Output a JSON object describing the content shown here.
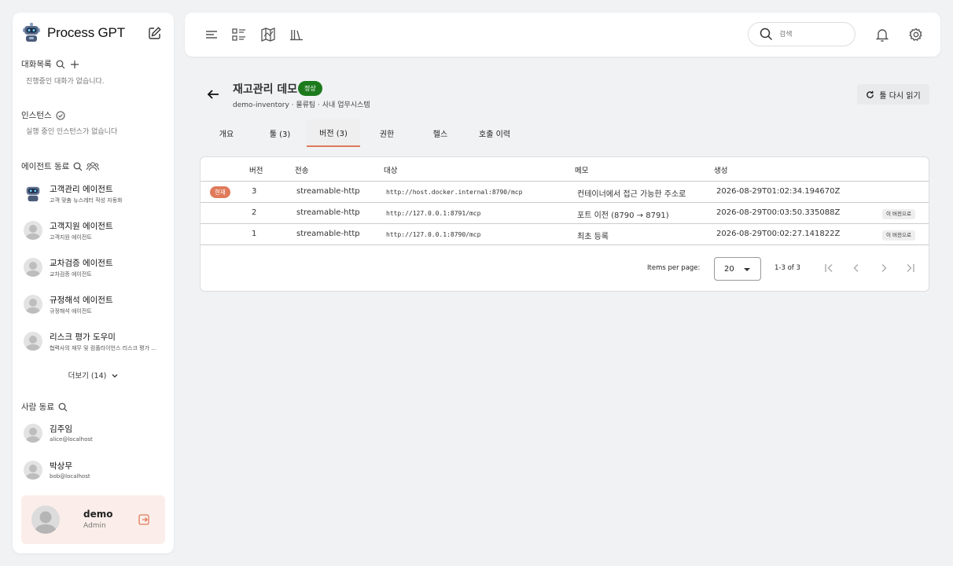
{
  "app": {
    "name": "Process GPT"
  },
  "sidebar": {
    "conversations": {
      "title": "대화목록",
      "empty": "진행중인 대화가 없습니다."
    },
    "instances": {
      "title": "인스턴스",
      "empty": "실행 중인 인스턴스가 없습니다"
    },
    "agents": {
      "title": "에이전트 동료",
      "items": [
        {
          "name": "고객관리 에이전트",
          "desc": "고객 맞춤 뉴스레터 작성 자동화"
        },
        {
          "name": "고객지원 에이전트",
          "desc": "고객지원 에이전트"
        },
        {
          "name": "교차검증 에이전트",
          "desc": "교차검증 에이전트"
        },
        {
          "name": "규정해석 에이전트",
          "desc": "규정해석 에이전트"
        },
        {
          "name": "리스크 평가 도우미",
          "desc": "협력사의 재무 및 컴플라이언스 리스크 평가 ..."
        }
      ],
      "more": "더보기 (14)"
    },
    "people": {
      "title": "사람 동료",
      "items": [
        {
          "name": "김주임",
          "email": "alice@localhost"
        },
        {
          "name": "박상무",
          "email": "bob@localhost"
        }
      ]
    },
    "user": {
      "name": "demo",
      "role": "Admin"
    }
  },
  "topbar": {
    "search_placeholder": "검색"
  },
  "page": {
    "title": "재고관리 데모",
    "status": "정상",
    "subtitle": "demo-inventory · 물류팀 · 사내 업무시스템",
    "reload_label": "툴 다시 읽기",
    "accent": "#e07a5a",
    "status_color": "#1c7a1c"
  },
  "tabs": [
    {
      "label": "개요"
    },
    {
      "label": "툴 (3)"
    },
    {
      "label": "버전 (3)"
    },
    {
      "label": "권한"
    },
    {
      "label": "헬스"
    },
    {
      "label": "호출 이력"
    }
  ],
  "table": {
    "headers": {
      "version": "버전",
      "transport": "전송",
      "target": "대상",
      "memo": "메모",
      "created": "생성"
    },
    "current_badge": "현재",
    "revert_label": "이 버전으로",
    "rows": [
      {
        "version": "3",
        "transport": "streamable-http",
        "target": "http://host.docker.internal:8790/mcp",
        "memo": "컨테이너에서 접근 가능한 주소로",
        "created": "2026-08-29T01:02:34.194670Z"
      },
      {
        "version": "2",
        "transport": "streamable-http",
        "target": "http://127.0.0.1:8791/mcp",
        "memo": "포트 이전 (8790 → 8791)",
        "created": "2026-08-29T00:03:50.335088Z"
      },
      {
        "version": "1",
        "transport": "streamable-http",
        "target": "http://127.0.0.1:8790/mcp",
        "memo": "최초 등록",
        "created": "2026-08-29T00:02:27.141822Z"
      }
    ]
  },
  "pagination": {
    "items_per_page_label": "Items per page:",
    "items_per_page": "20",
    "range": "1-3 of 3"
  }
}
